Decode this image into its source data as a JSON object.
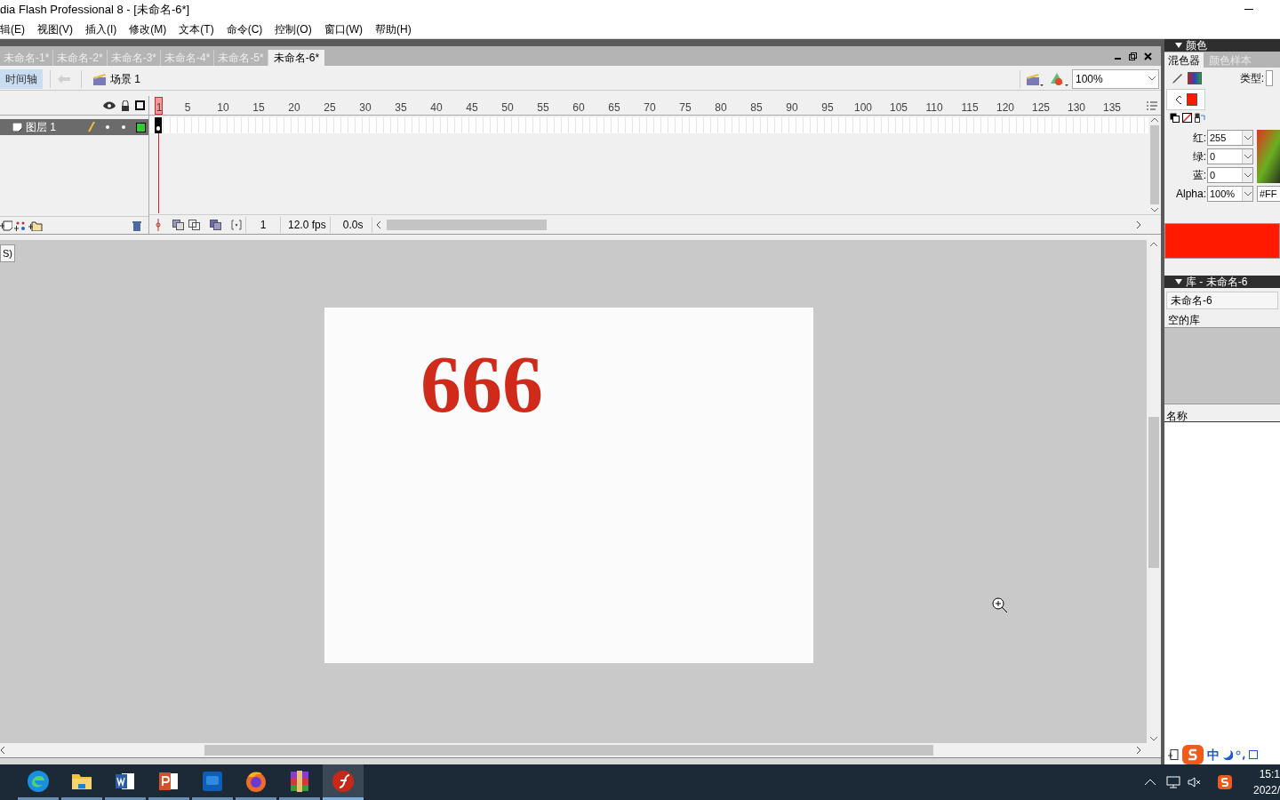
{
  "window": {
    "title": "dia Flash Professional 8 - [未命名-6*]"
  },
  "menu": [
    "辑(E)",
    "视图(V)",
    "插入(I)",
    "修改(M)",
    "文本(T)",
    "命令(C)",
    "控制(O)",
    "窗口(W)",
    "帮助(H)"
  ],
  "document_tabs": [
    {
      "label": "未命名-1*",
      "selected": false
    },
    {
      "label": "未命名-2*",
      "selected": false
    },
    {
      "label": "未命名-3*",
      "selected": false
    },
    {
      "label": "未命名-4*",
      "selected": false
    },
    {
      "label": "未命名-5*",
      "selected": false
    },
    {
      "label": "未命名-6*",
      "selected": true
    }
  ],
  "edit_bar": {
    "timeline_button": "时间轴",
    "scene": "场景 1",
    "zoom": "100%"
  },
  "timeline": {
    "frame_numbers": [
      "1",
      "5",
      "10",
      "15",
      "20",
      "25",
      "30",
      "35",
      "40",
      "45",
      "50",
      "55",
      "60",
      "65",
      "70",
      "75",
      "80",
      "85",
      "90",
      "95",
      "100",
      "105",
      "110",
      "115",
      "120",
      "125",
      "130",
      "135"
    ],
    "layers": [
      {
        "name": "图层 1",
        "selected": true,
        "color": "#33cc33"
      }
    ],
    "current_frame": "1",
    "frame_rate": "12.0 fps",
    "elapsed": "0.0s"
  },
  "stage": {
    "side_button": "S)",
    "text": "666"
  },
  "color_panel": {
    "title": "颜色",
    "tabs": [
      {
        "label": "混色器",
        "selected": true
      },
      {
        "label": "颜色样本",
        "selected": false
      }
    ],
    "type_label": "类型:",
    "channels": [
      {
        "label": "红:",
        "value": "255"
      },
      {
        "label": "绿:",
        "value": "0"
      },
      {
        "label": "蓝:",
        "value": "0"
      },
      {
        "label": "Alpha:",
        "value": "100%"
      }
    ],
    "hex": "#FF"
  },
  "library_panel": {
    "title": "库 - 未命名-6",
    "document": "未命名-6",
    "status": "空的库",
    "column": "名称"
  },
  "ime": {
    "mode": "中"
  },
  "taskbar": {
    "apps": [
      {
        "kind": "edge",
        "selected": false
      },
      {
        "kind": "folder",
        "selected": false
      },
      {
        "kind": "word",
        "selected": false
      },
      {
        "kind": "powerpoint",
        "selected": false
      },
      {
        "kind": "photoshop",
        "selected": false
      },
      {
        "kind": "firefox",
        "selected": false
      },
      {
        "kind": "archive",
        "selected": false
      },
      {
        "kind": "flash",
        "selected": true
      }
    ],
    "time": "15:1",
    "date": "2022/"
  }
}
